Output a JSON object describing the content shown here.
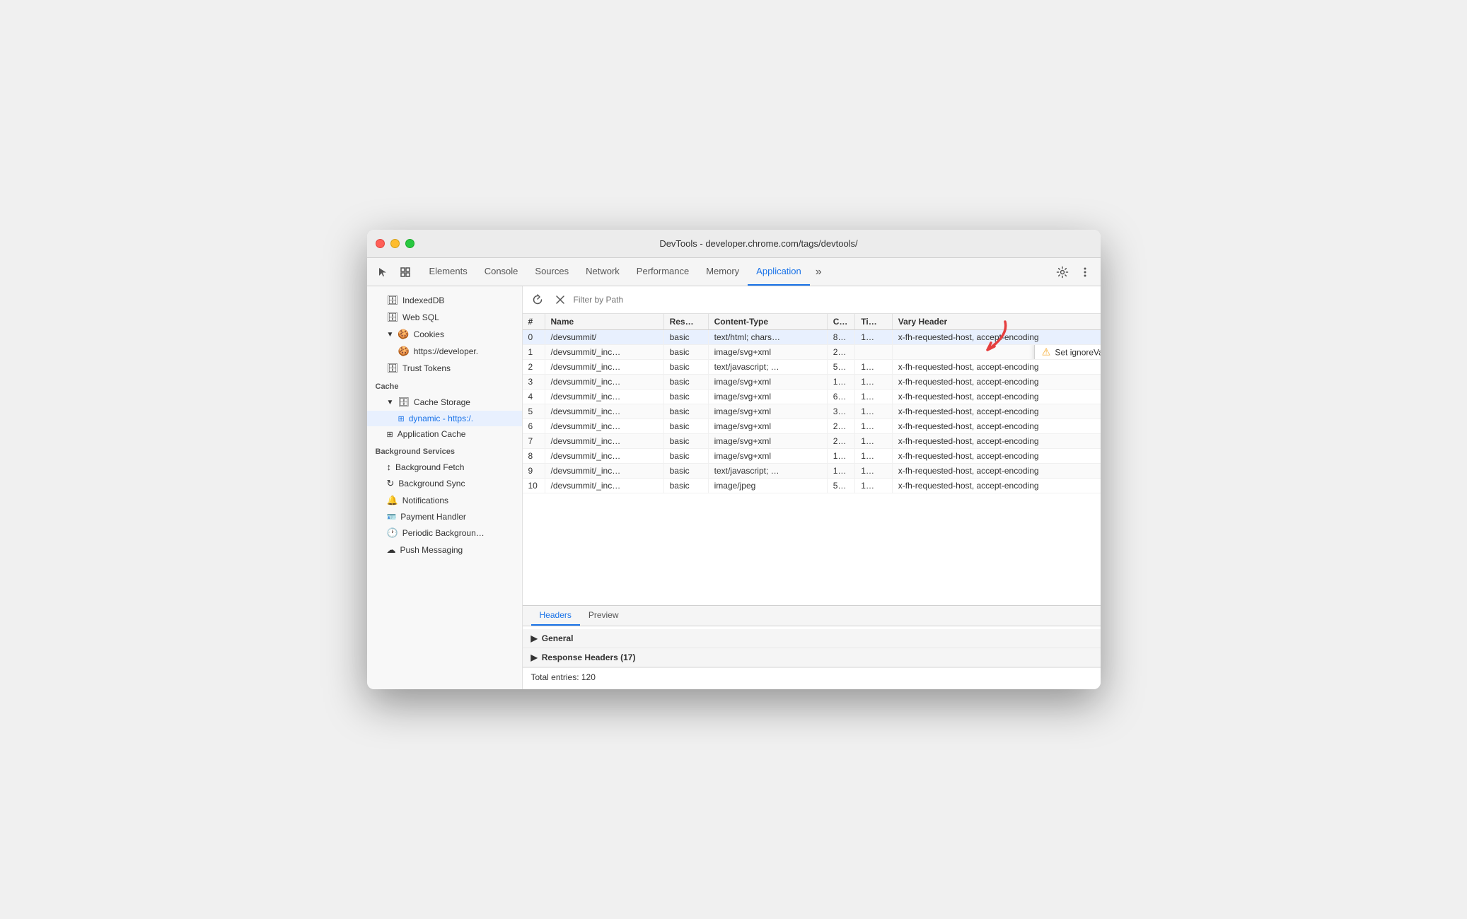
{
  "window": {
    "title": "DevTools - developer.chrome.com/tags/devtools/"
  },
  "tabs": [
    {
      "id": "elements",
      "label": "Elements",
      "active": false
    },
    {
      "id": "console",
      "label": "Console",
      "active": false
    },
    {
      "id": "sources",
      "label": "Sources",
      "active": false
    },
    {
      "id": "network",
      "label": "Network",
      "active": false
    },
    {
      "id": "performance",
      "label": "Performance",
      "active": false
    },
    {
      "id": "memory",
      "label": "Memory",
      "active": false
    },
    {
      "id": "application",
      "label": "Application",
      "active": true
    }
  ],
  "sidebar": {
    "sections": [
      {
        "id": "storage",
        "items": [
          {
            "id": "indexeddb",
            "label": "IndexedDB",
            "icon": "🗄",
            "indent": 1,
            "arrow": false
          },
          {
            "id": "websql",
            "label": "Web SQL",
            "icon": "🗄",
            "indent": 1,
            "arrow": false
          },
          {
            "id": "cookies",
            "label": "Cookies",
            "icon": "🍪",
            "indent": 1,
            "arrow": true,
            "expanded": true
          },
          {
            "id": "cookies-https",
            "label": "https://developer.",
            "icon": "🍪",
            "indent": 2,
            "arrow": false
          },
          {
            "id": "trust-tokens",
            "label": "Trust Tokens",
            "icon": "🗄",
            "indent": 1,
            "arrow": false
          }
        ]
      },
      {
        "id": "cache",
        "label": "Cache",
        "items": [
          {
            "id": "cache-storage",
            "label": "Cache Storage",
            "icon": "📦",
            "indent": 1,
            "arrow": true,
            "expanded": true
          },
          {
            "id": "dynamic",
            "label": "dynamic - https:/.",
            "icon": "⊞",
            "indent": 2,
            "arrow": false,
            "active": true
          },
          {
            "id": "app-cache",
            "label": "Application Cache",
            "icon": "⊞",
            "indent": 1,
            "arrow": false
          }
        ]
      },
      {
        "id": "bg-services",
        "label": "Background Services",
        "items": [
          {
            "id": "bg-fetch",
            "label": "Background Fetch",
            "icon": "↕",
            "indent": 1,
            "arrow": false
          },
          {
            "id": "bg-sync",
            "label": "Background Sync",
            "icon": "↻",
            "indent": 1,
            "arrow": false
          },
          {
            "id": "notifications",
            "label": "Notifications",
            "icon": "🔔",
            "indent": 1,
            "arrow": false
          },
          {
            "id": "payment-handler",
            "label": "Payment Handler",
            "icon": "🪪",
            "indent": 1,
            "arrow": false
          },
          {
            "id": "periodic-bg",
            "label": "Periodic Backgroun…",
            "icon": "🕐",
            "indent": 1,
            "arrow": false
          },
          {
            "id": "push-messaging",
            "label": "Push Messaging",
            "icon": "☁",
            "indent": 1,
            "arrow": false
          }
        ]
      }
    ]
  },
  "filter": {
    "placeholder": "Filter by Path"
  },
  "table": {
    "columns": [
      {
        "id": "num",
        "label": "#"
      },
      {
        "id": "name",
        "label": "Name"
      },
      {
        "id": "res",
        "label": "Res…"
      },
      {
        "id": "ct",
        "label": "Content-Type"
      },
      {
        "id": "c",
        "label": "C…"
      },
      {
        "id": "ti",
        "label": "Ti…"
      },
      {
        "id": "vh",
        "label": "Vary Header"
      }
    ],
    "rows": [
      {
        "num": "0",
        "name": "/devsummit/",
        "res": "basic",
        "ct": "text/html; chars…",
        "c": "8…",
        "ti": "1…",
        "vh": "x-fh-requested-host, accept-encoding",
        "selected": true
      },
      {
        "num": "1",
        "name": "/devsummit/_inc…",
        "res": "basic",
        "ct": "image/svg+xml",
        "c": "2…",
        "ti": "",
        "vh": "",
        "tooltip": true
      },
      {
        "num": "2",
        "name": "/devsummit/_inc…",
        "res": "basic",
        "ct": "text/javascript; …",
        "c": "5…",
        "ti": "1…",
        "vh": "x-fh-requested-host, accept-encoding"
      },
      {
        "num": "3",
        "name": "/devsummit/_inc…",
        "res": "basic",
        "ct": "image/svg+xml",
        "c": "1…",
        "ti": "1…",
        "vh": "x-fh-requested-host, accept-encoding"
      },
      {
        "num": "4",
        "name": "/devsummit/_inc…",
        "res": "basic",
        "ct": "image/svg+xml",
        "c": "6…",
        "ti": "1…",
        "vh": "x-fh-requested-host, accept-encoding"
      },
      {
        "num": "5",
        "name": "/devsummit/_inc…",
        "res": "basic",
        "ct": "image/svg+xml",
        "c": "3…",
        "ti": "1…",
        "vh": "x-fh-requested-host, accept-encoding"
      },
      {
        "num": "6",
        "name": "/devsummit/_inc…",
        "res": "basic",
        "ct": "image/svg+xml",
        "c": "2…",
        "ti": "1…",
        "vh": "x-fh-requested-host, accept-encoding"
      },
      {
        "num": "7",
        "name": "/devsummit/_inc…",
        "res": "basic",
        "ct": "image/svg+xml",
        "c": "2…",
        "ti": "1…",
        "vh": "x-fh-requested-host, accept-encoding"
      },
      {
        "num": "8",
        "name": "/devsummit/_inc…",
        "res": "basic",
        "ct": "image/svg+xml",
        "c": "1…",
        "ti": "1…",
        "vh": "x-fh-requested-host, accept-encoding"
      },
      {
        "num": "9",
        "name": "/devsummit/_inc…",
        "res": "basic",
        "ct": "text/javascript; …",
        "c": "1…",
        "ti": "1…",
        "vh": "x-fh-requested-host, accept-encoding"
      },
      {
        "num": "10",
        "name": "/devsummit/_inc…",
        "res": "basic",
        "ct": "image/jpeg",
        "c": "5…",
        "ti": "1…",
        "vh": "x-fh-requested-host, accept-encoding"
      }
    ],
    "tooltip_text": "Set ignoreVary to true when matching this entry"
  },
  "bottom_panel": {
    "tabs": [
      {
        "id": "headers",
        "label": "Headers",
        "active": true
      },
      {
        "id": "preview",
        "label": "Preview",
        "active": false
      }
    ],
    "sections": [
      {
        "id": "general",
        "label": "General"
      },
      {
        "id": "response-headers",
        "label": "Response Headers (17)"
      }
    ],
    "total_entries": "Total entries: 120"
  }
}
